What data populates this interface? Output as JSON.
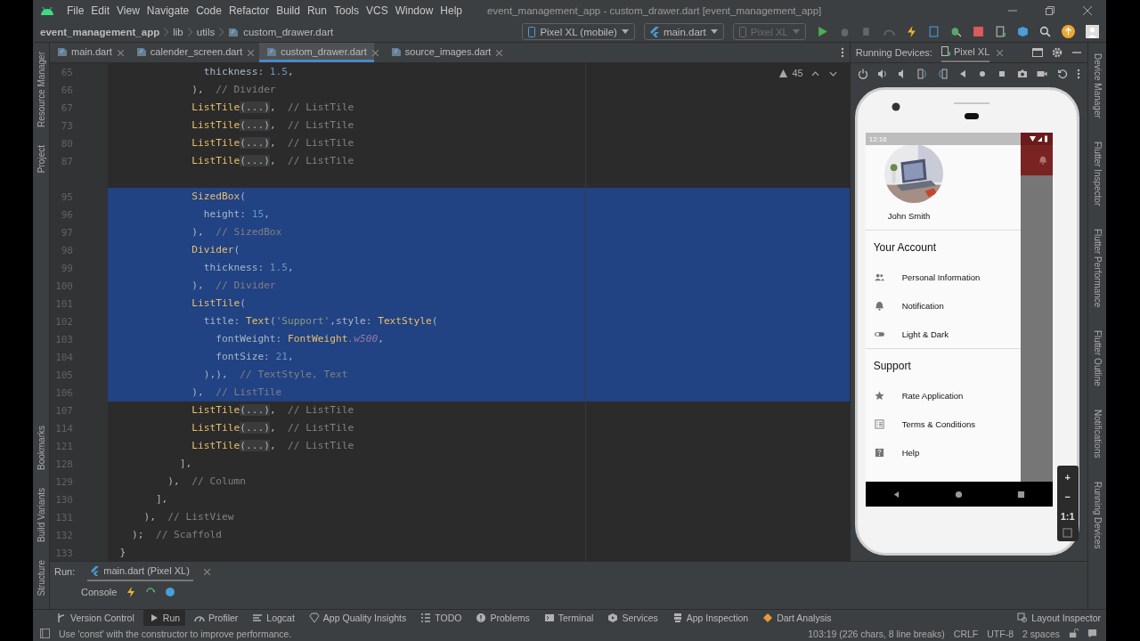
{
  "window": {
    "title": "event_management_app - custom_drawer.dart [event_management_app]"
  },
  "menu": [
    "File",
    "Edit",
    "View",
    "Navigate",
    "Code",
    "Refactor",
    "Build",
    "Run",
    "Tools",
    "VCS",
    "Window",
    "Help"
  ],
  "breadcrumb": [
    "event_management_app",
    "lib",
    "utils",
    "custom_drawer.dart"
  ],
  "toolbar": {
    "device": "Pixel XL (mobile)",
    "config": "main.dart",
    "target": {
      "label": "Pixel XL",
      "disabled": true
    }
  },
  "left_stripe": {
    "top": [
      "Resource Manager",
      "Project"
    ],
    "bottom": [
      "Bookmarks",
      "Build Variants",
      "Structure"
    ]
  },
  "tabs": [
    {
      "label": "main.dart",
      "selected": false
    },
    {
      "label": "calender_screen.dart",
      "selected": false
    },
    {
      "label": "custom_drawer.dart",
      "selected": true
    },
    {
      "label": "source_images.dart",
      "selected": false
    }
  ],
  "editor": {
    "warnings": "45",
    "lines": [
      {
        "number": "65",
        "selected": false,
        "segments": [
          {
            "kind": "plain",
            "text": "                thickness: "
          },
          {
            "kind": "num",
            "text": "1.5"
          },
          {
            "kind": "plain",
            "text": ","
          }
        ]
      },
      {
        "number": "66",
        "selected": false,
        "segments": [
          {
            "kind": "plain",
            "text": "              ),  "
          },
          {
            "kind": "comment",
            "text": "// Divider"
          }
        ]
      },
      {
        "number": "67",
        "selected": false,
        "segments": [
          {
            "kind": "cls",
            "text": "              ListTile"
          },
          {
            "kind": "fold",
            "text": "(...)"
          },
          {
            "kind": "plain",
            "text": ",  "
          },
          {
            "kind": "comment",
            "text": "// ListTile"
          }
        ]
      },
      {
        "number": "73",
        "selected": false,
        "segments": [
          {
            "kind": "cls",
            "text": "              ListTile"
          },
          {
            "kind": "fold",
            "text": "(...)"
          },
          {
            "kind": "plain",
            "text": ",  "
          },
          {
            "kind": "comment",
            "text": "// ListTile"
          }
        ]
      },
      {
        "number": "80",
        "selected": false,
        "segments": [
          {
            "kind": "cls",
            "text": "              ListTile"
          },
          {
            "kind": "fold",
            "text": "(...)"
          },
          {
            "kind": "plain",
            "text": ",  "
          },
          {
            "kind": "comment",
            "text": "// ListTile"
          }
        ]
      },
      {
        "number": "87",
        "selected": false,
        "segments": [
          {
            "kind": "cls",
            "text": "              ListTile"
          },
          {
            "kind": "fold",
            "text": "(...)"
          },
          {
            "kind": "plain",
            "text": ",  "
          },
          {
            "kind": "comment",
            "text": "// ListTile"
          }
        ]
      },
      {
        "number": "95",
        "gap_before": true,
        "selected": true,
        "segments": [
          {
            "kind": "cls",
            "text": "              SizedBox"
          },
          {
            "kind": "plain",
            "text": "("
          }
        ]
      },
      {
        "number": "96",
        "selected": true,
        "segments": [
          {
            "kind": "plain",
            "text": "                height: "
          },
          {
            "kind": "num",
            "text": "15"
          },
          {
            "kind": "plain",
            "text": ","
          }
        ]
      },
      {
        "number": "97",
        "selected": true,
        "segments": [
          {
            "kind": "plain",
            "text": "              ),  "
          },
          {
            "kind": "comment",
            "text": "// SizedBox"
          }
        ]
      },
      {
        "number": "98",
        "selected": true,
        "segments": [
          {
            "kind": "cls",
            "text": "              Divider"
          },
          {
            "kind": "plain",
            "text": "("
          }
        ]
      },
      {
        "number": "99",
        "selected": true,
        "segments": [
          {
            "kind": "plain",
            "text": "                thickness: "
          },
          {
            "kind": "num",
            "text": "1.5"
          },
          {
            "kind": "plain",
            "text": ","
          }
        ]
      },
      {
        "number": "100",
        "selected": true,
        "segments": [
          {
            "kind": "plain",
            "text": "              ),  "
          },
          {
            "kind": "comment",
            "text": "// Divider"
          }
        ]
      },
      {
        "number": "101",
        "selected": true,
        "segments": [
          {
            "kind": "cls",
            "text": "              ListTile"
          },
          {
            "kind": "plain",
            "text": "("
          }
        ]
      },
      {
        "number": "102",
        "selected": true,
        "segments": [
          {
            "kind": "plain",
            "text": "                title: "
          },
          {
            "kind": "cls",
            "text": "Text"
          },
          {
            "kind": "plain",
            "text": "("
          },
          {
            "kind": "str",
            "text": "'Support'"
          },
          {
            "kind": "plain",
            "text": ",style: "
          },
          {
            "kind": "cls",
            "text": "TextStyle"
          },
          {
            "kind": "plain",
            "text": "("
          }
        ]
      },
      {
        "number": "103",
        "selected": true,
        "segments": [
          {
            "kind": "plain",
            "text": "                  fontWeight: "
          },
          {
            "kind": "cls",
            "text": "FontWeight"
          },
          {
            "kind": "prop",
            "text": ".w500"
          },
          {
            "kind": "plain",
            "text": ","
          }
        ]
      },
      {
        "number": "104",
        "selected": true,
        "segments": [
          {
            "kind": "plain",
            "text": "                  fontSize: "
          },
          {
            "kind": "num",
            "text": "21"
          },
          {
            "kind": "plain",
            "text": ","
          }
        ]
      },
      {
        "number": "105",
        "selected": true,
        "segments": [
          {
            "kind": "plain",
            "text": "                ),),  "
          },
          {
            "kind": "comment",
            "text": "// TextStyle, Text"
          }
        ]
      },
      {
        "number": "106",
        "selected": true,
        "segments": [
          {
            "kind": "plain",
            "text": "              ),  "
          },
          {
            "kind": "comment",
            "text": "// ListTile"
          }
        ]
      },
      {
        "number": "107",
        "selected": false,
        "segments": [
          {
            "kind": "cls",
            "text": "              ListTile"
          },
          {
            "kind": "fold",
            "text": "(...)"
          },
          {
            "kind": "plain",
            "text": ",  "
          },
          {
            "kind": "comment",
            "text": "// ListTile"
          }
        ]
      },
      {
        "number": "114",
        "selected": false,
        "segments": [
          {
            "kind": "cls",
            "text": "              ListTile"
          },
          {
            "kind": "fold",
            "text": "(...)"
          },
          {
            "kind": "plain",
            "text": ",  "
          },
          {
            "kind": "comment",
            "text": "// ListTile"
          }
        ]
      },
      {
        "number": "121",
        "selected": false,
        "segments": [
          {
            "kind": "cls",
            "text": "              ListTile"
          },
          {
            "kind": "fold",
            "text": "(...)"
          },
          {
            "kind": "plain",
            "text": ",  "
          },
          {
            "kind": "comment",
            "text": "// ListTile"
          }
        ]
      },
      {
        "number": "128",
        "selected": false,
        "segments": [
          {
            "kind": "plain",
            "text": "            ],"
          }
        ]
      },
      {
        "number": "129",
        "selected": false,
        "segments": [
          {
            "kind": "plain",
            "text": "          ),  "
          },
          {
            "kind": "comment",
            "text": "// Column"
          }
        ]
      },
      {
        "number": "130",
        "selected": false,
        "segments": [
          {
            "kind": "plain",
            "text": "        ],"
          }
        ]
      },
      {
        "number": "131",
        "selected": false,
        "segments": [
          {
            "kind": "plain",
            "text": "      ),  "
          },
          {
            "kind": "comment",
            "text": "// ListView"
          }
        ]
      },
      {
        "number": "132",
        "selected": false,
        "segments": [
          {
            "kind": "plain",
            "text": "    );  "
          },
          {
            "kind": "comment",
            "text": "// Scaffold"
          }
        ]
      },
      {
        "number": "133",
        "selected": false,
        "segments": [
          {
            "kind": "plain",
            "text": "  }"
          }
        ]
      }
    ]
  },
  "running_devices": {
    "title": "Running Devices:",
    "tab": "Pixel XL"
  },
  "phone": {
    "status_time": "12:16",
    "user_name": "John Smith",
    "sections": [
      {
        "title": "Your Account",
        "items": [
          {
            "kind": "people",
            "label": "Personal Information"
          },
          {
            "kind": "bell",
            "label": "Notification"
          },
          {
            "kind": "toggle",
            "label": "Light & Dark"
          }
        ]
      },
      {
        "title": "Support",
        "items": [
          {
            "kind": "star",
            "label": "Rate Application"
          },
          {
            "kind": "list",
            "label": "Terms & Conditions"
          },
          {
            "kind": "help",
            "label": "Help"
          }
        ]
      }
    ],
    "zoom_controls": [
      "+",
      "−",
      "1:1"
    ]
  },
  "right_stripe": [
    "Device Manager",
    "Flutter Inspector",
    "Flutter Performance",
    "Flutter Outline",
    "Notifications",
    "Running Devices"
  ],
  "run_panel": {
    "label": "Run:",
    "tab": "main.dart (Pixel XL)",
    "console": "Console"
  },
  "tool_windows": [
    {
      "kind": "vcs",
      "label": "Version Control",
      "selected": false
    },
    {
      "kind": "run",
      "label": "Run",
      "selected": true
    },
    {
      "kind": "profiler",
      "label": "Profiler",
      "selected": false
    },
    {
      "kind": "logcat",
      "label": "Logcat",
      "selected": false
    },
    {
      "kind": "gem",
      "label": "App Quality Insights",
      "selected": false
    },
    {
      "kind": "todo",
      "label": "TODO",
      "selected": false
    },
    {
      "kind": "problems",
      "label": "Problems",
      "selected": false
    },
    {
      "kind": "terminal",
      "label": "Terminal",
      "selected": false
    },
    {
      "kind": "services",
      "label": "Services",
      "selected": false
    },
    {
      "kind": "inspection",
      "label": "App Inspection",
      "selected": false
    },
    {
      "kind": "dart",
      "label": "Dart Analysis",
      "selected": false
    }
  ],
  "layout_inspector": "Layout Inspector",
  "status_bar": {
    "message": "Use 'const' with the constructor to improve performance.",
    "position": "103:19 (226 chars, 8 line breaks)",
    "line_separator": "CRLF",
    "encoding": "UTF-8",
    "indent": "2 spaces"
  }
}
